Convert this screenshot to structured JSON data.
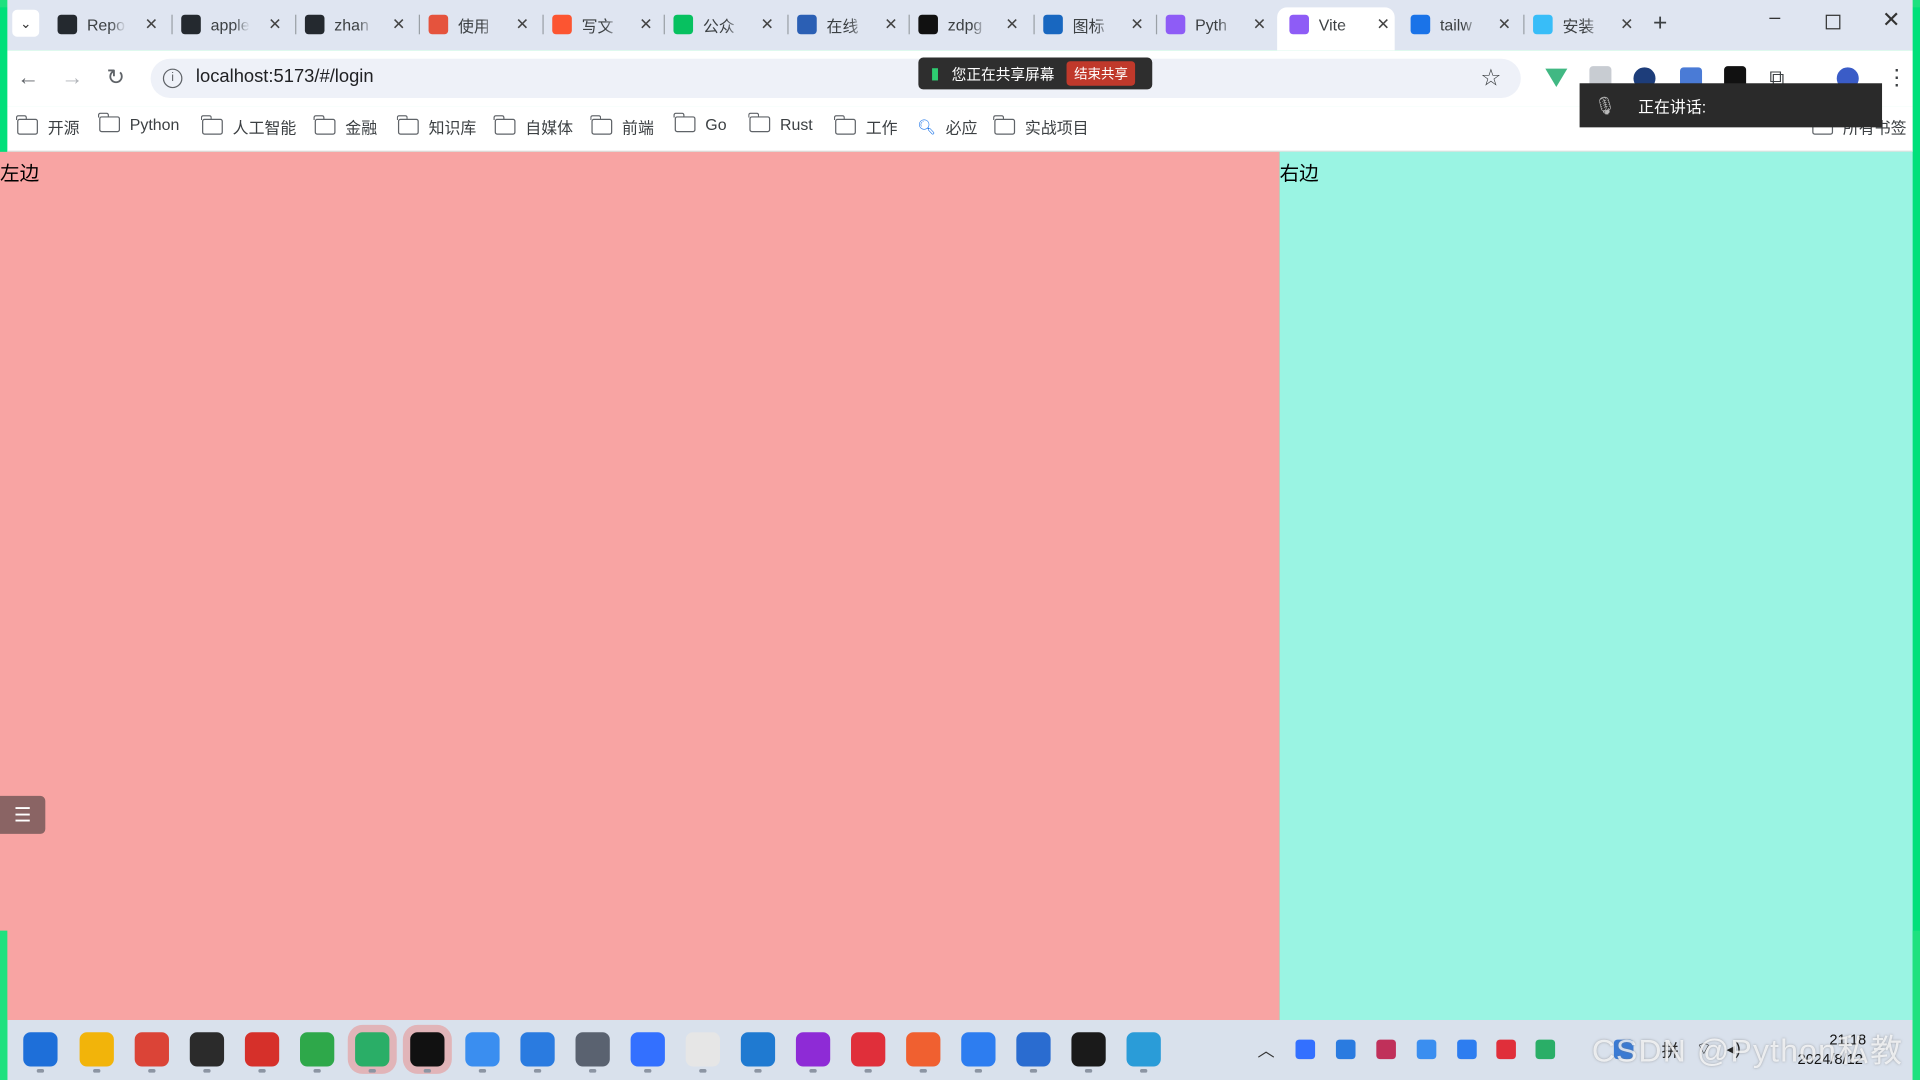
{
  "tabs": [
    {
      "title": "Repo",
      "icon": "github-icon",
      "color": "#24292f"
    },
    {
      "title": "apple",
      "icon": "github-icon",
      "color": "#24292f"
    },
    {
      "title": "zhan",
      "icon": "github-icon",
      "color": "#24292f"
    },
    {
      "title": "使用",
      "icon": "chatgpt-icon",
      "color": "#e5533d"
    },
    {
      "title": "写文",
      "icon": "csdn-icon",
      "color": "#fc5531"
    },
    {
      "title": "公众",
      "icon": "wechat-mp-icon",
      "color": "#07c160"
    },
    {
      "title": "在线",
      "icon": "n-logo-icon",
      "color": "#2b5fb4"
    },
    {
      "title": "zdpg",
      "icon": "ta-icon",
      "color": "#111111"
    },
    {
      "title": "图标",
      "icon": "vuetify-icon",
      "color": "#1867c0"
    },
    {
      "title": "Pyth",
      "icon": "vite-icon",
      "color": "#8e5cf6"
    },
    {
      "title": "Vite",
      "icon": "vite-icon",
      "color": "#8e5cf6"
    },
    {
      "title": "tailw",
      "icon": "search-icon",
      "color": "#1a73e8"
    },
    {
      "title": "安装",
      "icon": "tailwind-icon",
      "color": "#38bdf8"
    }
  ],
  "address": {
    "url": "localhost:5173/#/login"
  },
  "bookmarks": [
    "开源",
    "Python",
    "人工智能",
    "金融",
    "知识库",
    "自媒体",
    "前端",
    "Go",
    "Rust",
    "工作",
    "必应",
    "实战项目"
  ],
  "bookmarks_all": "所有书签",
  "share": {
    "text": "您正在共享屏幕",
    "end": "结束共享"
  },
  "speaking": {
    "text": "正在讲话:"
  },
  "panes": {
    "left": "左边",
    "right": "右边"
  },
  "clock": {
    "time": "21:18",
    "date": "2024/8/12"
  },
  "tray_lang": "拼",
  "watermark": "CSDN @Python私教",
  "colors": {
    "left": "#f8a4a3",
    "right": "#9af4e3",
    "frame": "#1ee17f"
  }
}
